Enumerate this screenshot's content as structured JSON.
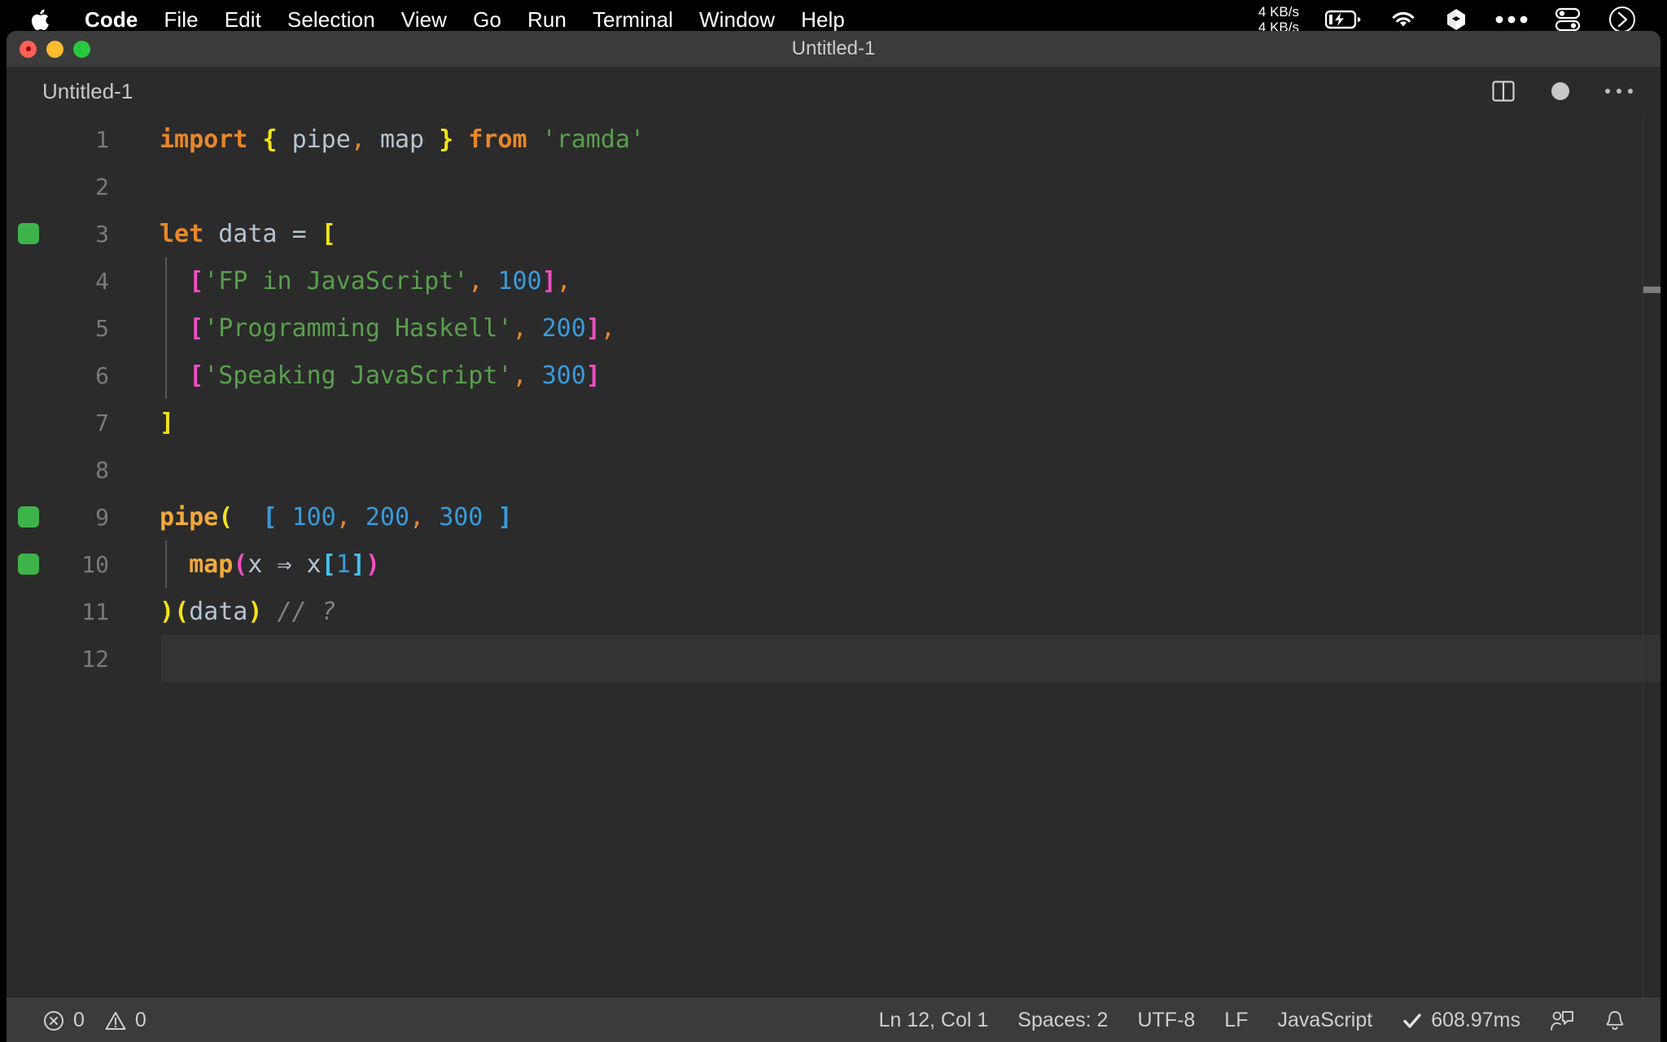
{
  "menubar": {
    "apple_icon": "apple-logo-icon",
    "items": [
      {
        "label": "Code",
        "bold": true
      },
      {
        "label": "File",
        "bold": false
      },
      {
        "label": "Edit",
        "bold": false
      },
      {
        "label": "Selection",
        "bold": false
      },
      {
        "label": "View",
        "bold": false
      },
      {
        "label": "Go",
        "bold": false
      },
      {
        "label": "Run",
        "bold": false
      },
      {
        "label": "Terminal",
        "bold": false
      },
      {
        "label": "Window",
        "bold": false
      },
      {
        "label": "Help",
        "bold": false
      }
    ],
    "status": {
      "network_up": "4 KB/s",
      "network_down": "4 KB/s",
      "battery_icon": "battery-charging-icon",
      "wifi_icon": "wifi-icon",
      "dropbox_icon": "dropbox-icon",
      "more_icon": "ellipsis-icon",
      "control_center_icon": "control-center-icon",
      "siri_icon": "siri-icon"
    }
  },
  "window": {
    "title": "Untitled-1",
    "traffic_lights": [
      "close",
      "minimize",
      "maximize"
    ]
  },
  "tabbar": {
    "tab_label": "Untitled-1",
    "actions": {
      "split_editor": "split-editor-icon",
      "unsaved_dot": "unsaved-indicator-icon",
      "more_actions": "more-actions-icon"
    }
  },
  "editor": {
    "language": "JavaScript",
    "current_line": 12,
    "lines": [
      {
        "num": "1",
        "breakpoint": false,
        "current": false,
        "indent_guide": false
      },
      {
        "num": "2",
        "breakpoint": false,
        "current": false,
        "indent_guide": false
      },
      {
        "num": "3",
        "breakpoint": true,
        "current": false,
        "indent_guide": false
      },
      {
        "num": "4",
        "breakpoint": false,
        "current": false,
        "indent_guide": true
      },
      {
        "num": "5",
        "breakpoint": false,
        "current": false,
        "indent_guide": true
      },
      {
        "num": "6",
        "breakpoint": false,
        "current": false,
        "indent_guide": true
      },
      {
        "num": "7",
        "breakpoint": false,
        "current": false,
        "indent_guide": false
      },
      {
        "num": "8",
        "breakpoint": false,
        "current": false,
        "indent_guide": false
      },
      {
        "num": "9",
        "breakpoint": true,
        "current": false,
        "indent_guide": false
      },
      {
        "num": "10",
        "breakpoint": true,
        "current": false,
        "indent_guide": true
      },
      {
        "num": "11",
        "breakpoint": false,
        "current": false,
        "indent_guide": false
      },
      {
        "num": "12",
        "breakpoint": false,
        "current": true,
        "indent_guide": false
      }
    ],
    "source_text": [
      "import { pipe, map } from 'ramda'",
      "",
      "let data = [",
      "  ['FP in JavaScript', 100],",
      "  ['Programming Haskell', 200],",
      "  ['Speaking JavaScript', 300]",
      "]",
      "",
      "pipe(  [ 100, 200, 300 ]",
      "  map(x ⇒ x[1])",
      ")(data) // ?",
      ""
    ]
  },
  "statusbar": {
    "error_icon": "error-circle-icon",
    "error_count": "0",
    "warning_icon": "warning-triangle-icon",
    "warning_count": "0",
    "cursor_position": "Ln 12, Col 1",
    "indentation": "Spaces: 2",
    "encoding": "UTF-8",
    "eol": "LF",
    "language_mode": "JavaScript",
    "quokka_icon": "check-icon",
    "quokka_time": "608.97ms",
    "feedback_icon": "feedback-icon",
    "bell_icon": "notification-bell-icon"
  },
  "theme": {
    "editor_bg": "#2b2b2b",
    "titlebar_bg": "#3b3b3b",
    "statusbar_bg": "#3b3b3b",
    "breakpoint_green": "#3eb34b",
    "keyword_orange": "#e8872b",
    "string_green": "#5a9e4e",
    "number_blue": "#3a9ad9",
    "function_yellow": "#f2a93b",
    "bracket_yellow": "#f4e318",
    "bracket_pink": "#ef4fc4",
    "bracket_cyan": "#45c2f0",
    "comment_gray": "#808080",
    "text_default": "#b8c4cf",
    "linenumber_gray": "#7a7a7a"
  }
}
